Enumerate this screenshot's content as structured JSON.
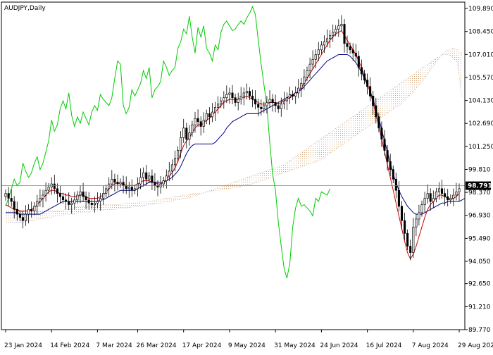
{
  "chart_data": {
    "type": "candlestick",
    "title": "AUDJPY,Daily",
    "symbol": "AUDJPY",
    "timeframe": "Daily",
    "ylim": [
      89.77,
      110.2
    ],
    "y_ticks": [
      "109.890",
      "108.450",
      "107.010",
      "105.570",
      "104.130",
      "102.690",
      "101.250",
      "99.810",
      "98.370",
      "96.930",
      "95.490",
      "94.050",
      "92.650",
      "91.210",
      "89.770"
    ],
    "x_ticks": [
      {
        "label": "23 Jan 2024",
        "index": 0
      },
      {
        "label": "14 Feb 2024",
        "index": 16
      },
      {
        "label": "7 Mar 2024",
        "index": 32
      },
      {
        "label": "26 Mar 2024",
        "index": 46
      },
      {
        "label": "17 Apr 2024",
        "index": 62
      },
      {
        "label": "9 May 2024",
        "index": 78
      },
      {
        "label": "31 May 2024",
        "index": 94
      },
      {
        "label": "24 Jun 2024",
        "index": 110
      },
      {
        "label": "16 Jul 2024",
        "index": 126
      },
      {
        "label": "7 Aug 2024",
        "index": 142
      },
      {
        "label": "29 Aug 2024",
        "index": 158
      }
    ],
    "current_price": "98.791",
    "current_price_value": 98.791,
    "colors": {
      "bull": "#000000",
      "bear": "#000000",
      "tenkan": "#cc0000",
      "kijun": "#000080",
      "chikou": "#00cc00",
      "cloud_a": "#d2a679",
      "cloud_b": "#b0a8c8",
      "price_line": "#808080",
      "axis": "#000000"
    },
    "closes": [
      98.3,
      98.0,
      97.8,
      97.3,
      97.0,
      96.8,
      96.6,
      97.0,
      97.3,
      97.2,
      97.5,
      97.8,
      98.0,
      98.2,
      98.5,
      98.7,
      98.9,
      98.6,
      98.3,
      98.1,
      97.9,
      97.8,
      97.6,
      97.7,
      97.9,
      98.2,
      98.4,
      98.1,
      97.9,
      97.7,
      97.6,
      97.7,
      97.8,
      98.0,
      98.3,
      98.6,
      98.9,
      99.2,
      99.0,
      98.9,
      99.0,
      98.8,
      98.6,
      98.7,
      98.5,
      98.6,
      98.9,
      99.3,
      99.6,
      99.2,
      99.4,
      99.0,
      98.8,
      98.7,
      98.9,
      99.1,
      99.4,
      99.7,
      100.1,
      100.5,
      101.0,
      101.8,
      102.4,
      101.7,
      102.1,
      102.6,
      103.0,
      102.8,
      102.5,
      102.9,
      103.3,
      103.1,
      103.4,
      103.7,
      103.9,
      104.1,
      104.3,
      104.5,
      104.6,
      104.3,
      104.0,
      104.2,
      104.4,
      104.6,
      104.7,
      104.4,
      104.2,
      103.9,
      103.7,
      103.6,
      103.8,
      104.0,
      104.2,
      104.0,
      103.8,
      103.6,
      103.9,
      104.1,
      104.3,
      104.5,
      104.4,
      104.6,
      104.9,
      105.2,
      105.6,
      106.0,
      106.4,
      106.7,
      107.0,
      107.3,
      107.6,
      107.8,
      108.0,
      108.2,
      108.4,
      108.6,
      108.8,
      108.9,
      107.7,
      107.5,
      107.3,
      107.1,
      106.9,
      106.2,
      105.8,
      105.4,
      105.0,
      104.4,
      103.8,
      103.1,
      102.4,
      101.7,
      101.0,
      100.3,
      99.8,
      99.2,
      98.5,
      97.5,
      96.6,
      95.8,
      95.0,
      94.6,
      96.2,
      96.7,
      97.1,
      97.6,
      98.0,
      98.3,
      97.8,
      98.0,
      98.4,
      98.6,
      98.3,
      98.1,
      97.9,
      98.0,
      98.2,
      98.4,
      98.6
    ],
    "tenkan": [
      97.6,
      97.5,
      97.4,
      97.3,
      97.3,
      97.2,
      97.2,
      97.2,
      97.2,
      97.3,
      97.4,
      97.6,
      97.8,
      98.0,
      98.2,
      98.4,
      98.5,
      98.5,
      98.4,
      98.3,
      98.3,
      98.2,
      98.2,
      98.1,
      98.1,
      98.1,
      98.2,
      98.2,
      98.1,
      98.0,
      98.0,
      98.0,
      98.0,
      98.1,
      98.2,
      98.4,
      98.6,
      98.8,
      98.9,
      99.0,
      98.9,
      98.9,
      98.8,
      98.8,
      98.8,
      98.8,
      98.9,
      99.0,
      99.1,
      99.1,
      99.1,
      99.0,
      99.0,
      98.9,
      98.9,
      99.0,
      99.2,
      99.4,
      99.6,
      99.9,
      100.3,
      100.8,
      101.3,
      101.6,
      101.8,
      102.1,
      102.4,
      102.6,
      102.6,
      102.7,
      102.9,
      103.0,
      103.2,
      103.4,
      103.6,
      103.8,
      104.0,
      104.1,
      104.2,
      104.2,
      104.2,
      104.2,
      104.3,
      104.3,
      104.4,
      104.3,
      104.2,
      104.1,
      104.0,
      103.9,
      103.9,
      103.9,
      104.0,
      104.0,
      104.0,
      103.9,
      104.0,
      104.1,
      104.2,
      104.3,
      104.4,
      104.5,
      104.7,
      104.9,
      105.2,
      105.5,
      105.8,
      106.1,
      106.4,
      106.7,
      107.0,
      107.3,
      107.6,
      107.9,
      108.1,
      108.3,
      108.4,
      108.5,
      108.2,
      107.9,
      107.6,
      107.3,
      107.0,
      106.6,
      106.2,
      105.7,
      105.2,
      104.6,
      104.0,
      103.3,
      102.5,
      101.7,
      100.9,
      100.1,
      99.3,
      98.5,
      97.7,
      96.9,
      96.1,
      95.3,
      94.6,
      94.2,
      94.5,
      95.0,
      95.6,
      96.2,
      96.8,
      97.3,
      97.6,
      97.8,
      98.0,
      98.2,
      98.2,
      98.1,
      98.0,
      97.9,
      98.0,
      98.1,
      98.3
    ],
    "kijun": [
      97.1,
      97.1,
      97.1,
      97.1,
      97.1,
      97.0,
      97.0,
      97.0,
      97.0,
      97.0,
      97.0,
      97.0,
      97.0,
      97.1,
      97.2,
      97.3,
      97.4,
      97.5,
      97.6,
      97.7,
      97.8,
      97.8,
      97.8,
      97.8,
      97.8,
      97.8,
      97.8,
      97.8,
      97.8,
      97.8,
      97.8,
      97.8,
      97.8,
      97.9,
      97.9,
      98.0,
      98.1,
      98.2,
      98.3,
      98.4,
      98.5,
      98.5,
      98.5,
      98.5,
      98.5,
      98.5,
      98.6,
      98.7,
      98.8,
      98.9,
      99.0,
      99.0,
      99.0,
      99.0,
      99.0,
      99.0,
      99.1,
      99.2,
      99.3,
      99.5,
      99.7,
      100.0,
      100.4,
      100.8,
      101.1,
      101.3,
      101.4,
      101.4,
      101.4,
      101.4,
      101.4,
      101.4,
      101.4,
      101.5,
      101.7,
      101.9,
      102.1,
      102.4,
      102.6,
      102.8,
      102.9,
      103.0,
      103.1,
      103.2,
      103.3,
      103.3,
      103.3,
      103.3,
      103.3,
      103.4,
      103.5,
      103.6,
      103.7,
      103.8,
      103.9,
      104.0,
      104.1,
      104.2,
      104.3,
      104.4,
      104.5,
      104.6,
      104.7,
      104.8,
      105.0,
      105.2,
      105.4,
      105.6,
      105.8,
      106.0,
      106.2,
      106.4,
      106.6,
      106.7,
      106.8,
      106.9,
      107.0,
      107.0,
      107.0,
      107.0,
      106.9,
      106.7,
      106.5,
      106.2,
      105.9,
      105.5,
      105.1,
      104.7,
      104.2,
      103.6,
      103.0,
      102.3,
      101.6,
      100.9,
      100.2,
      99.5,
      99.0,
      98.5,
      98.1,
      97.8,
      97.5,
      97.3,
      97.1,
      97.0,
      97.0,
      97.0,
      97.1,
      97.2,
      97.3,
      97.4,
      97.5,
      97.6,
      97.7,
      97.7,
      97.8,
      97.8,
      97.8,
      97.8,
      97.8,
      97.9,
      98.0
    ],
    "senkou_a": [
      97.2,
      97.2,
      97.2,
      97.2,
      97.2,
      97.2,
      97.2,
      97.2,
      97.2,
      97.2,
      97.2,
      97.2,
      97.2,
      97.3,
      97.3,
      97.4,
      97.5,
      97.5,
      97.5,
      97.5,
      97.6,
      97.6,
      97.6,
      97.6,
      97.6,
      97.6,
      97.7,
      97.7,
      97.7,
      97.7,
      97.8,
      97.8,
      97.8,
      97.9,
      97.9,
      98.0,
      98.0,
      98.1,
      98.1,
      98.2,
      98.2,
      98.3,
      98.3,
      98.3,
      98.4,
      98.4,
      98.5,
      98.5,
      98.6,
      98.6,
      98.7,
      98.7,
      98.8,
      98.8,
      98.9,
      99.0,
      99.1,
      99.2,
      99.3,
      99.4,
      99.5,
      99.6,
      99.7,
      99.8,
      99.9,
      100.0,
      100.1,
      100.2,
      100.3,
      100.4,
      100.6,
      100.8,
      101.0,
      101.2,
      101.4,
      101.6,
      101.8,
      102.0,
      102.2,
      102.4,
      102.6,
      102.8,
      103.0,
      103.2,
      103.4,
      103.6,
      103.8,
      104.0,
      104.3,
      104.6,
      104.9,
      105.2,
      105.6,
      106.0,
      106.4,
      106.8,
      107.1,
      107.3,
      107.4,
      107.3,
      107.0
    ],
    "senkou_b": [
      96.5,
      96.5,
      96.5,
      96.5,
      96.5,
      96.6,
      96.6,
      96.7,
      96.7,
      96.8,
      96.8,
      96.9,
      96.9,
      97.0,
      97.0,
      97.0,
      97.1,
      97.1,
      97.1,
      97.2,
      97.2,
      97.2,
      97.3,
      97.3,
      97.3,
      97.4,
      97.4,
      97.4,
      97.5,
      97.5,
      97.5,
      97.6,
      97.6,
      97.7,
      97.7,
      97.8,
      97.8,
      97.9,
      97.9,
      98.0,
      98.0,
      98.1,
      98.2,
      98.3,
      98.4,
      98.5,
      98.6,
      98.7,
      98.8,
      98.9,
      99.0,
      99.1,
      99.2,
      99.3,
      99.4,
      99.5,
      99.6,
      99.7,
      99.8,
      99.9,
      100.0,
      100.1,
      100.3,
      100.5,
      100.7,
      100.9,
      101.1,
      101.3,
      101.5,
      101.7,
      101.9,
      102.1,
      102.3,
      102.5,
      102.7,
      102.9,
      103.1,
      103.3,
      103.5,
      103.7,
      103.9,
      104.1,
      104.3,
      104.5,
      104.7,
      104.9,
      105.1,
      105.3,
      105.5,
      105.7,
      105.9,
      106.1,
      106.3,
      106.5,
      106.7,
      106.9,
      107.0,
      107.0,
      106.8,
      106.5,
      104.3
    ],
    "senkou_start_index": 62,
    "chikou": [
      97.5,
      98.0,
      98.6,
      99.2,
      98.8,
      99.0,
      100.2,
      99.7,
      99.3,
      99.6,
      100.2,
      100.6,
      99.8,
      100.2,
      100.9,
      101.6,
      102.9,
      102.2,
      102.6,
      103.6,
      104.1,
      103.6,
      104.6,
      103.2,
      102.5,
      103.1,
      102.7,
      103.4,
      103.0,
      102.6,
      103.4,
      103.8,
      103.5,
      104.5,
      104.2,
      104.0,
      103.8,
      104.3,
      105.5,
      106.6,
      106.4,
      103.8,
      103.3,
      103.7,
      104.8,
      104.4,
      104.8,
      105.2,
      106.0,
      105.5,
      106.2,
      104.3,
      104.8,
      105.0,
      105.3,
      106.6,
      106.2,
      105.7,
      106.0,
      106.2,
      107.4,
      107.8,
      108.6,
      108.3,
      109.4,
      108.1,
      107.1,
      108.7,
      108.1,
      108.8,
      107.4,
      107.1,
      106.6,
      107.6,
      107.3,
      108.4,
      108.9,
      109.1,
      108.8,
      108.5,
      108.6,
      108.9,
      109.1,
      108.9,
      109.3,
      109.6,
      110.0,
      109.5,
      107.9,
      106.4,
      105.1,
      103.8,
      101.5,
      99.5,
      98.5,
      96.5,
      95.0,
      93.6,
      93.0,
      93.9,
      96.2,
      97.4,
      98.0,
      97.5,
      97.6,
      97.4,
      97.2,
      96.9,
      98.0,
      97.8,
      98.4,
      98.3,
      98.2,
      98.6
    ],
    "chikou_start_index": 10
  }
}
